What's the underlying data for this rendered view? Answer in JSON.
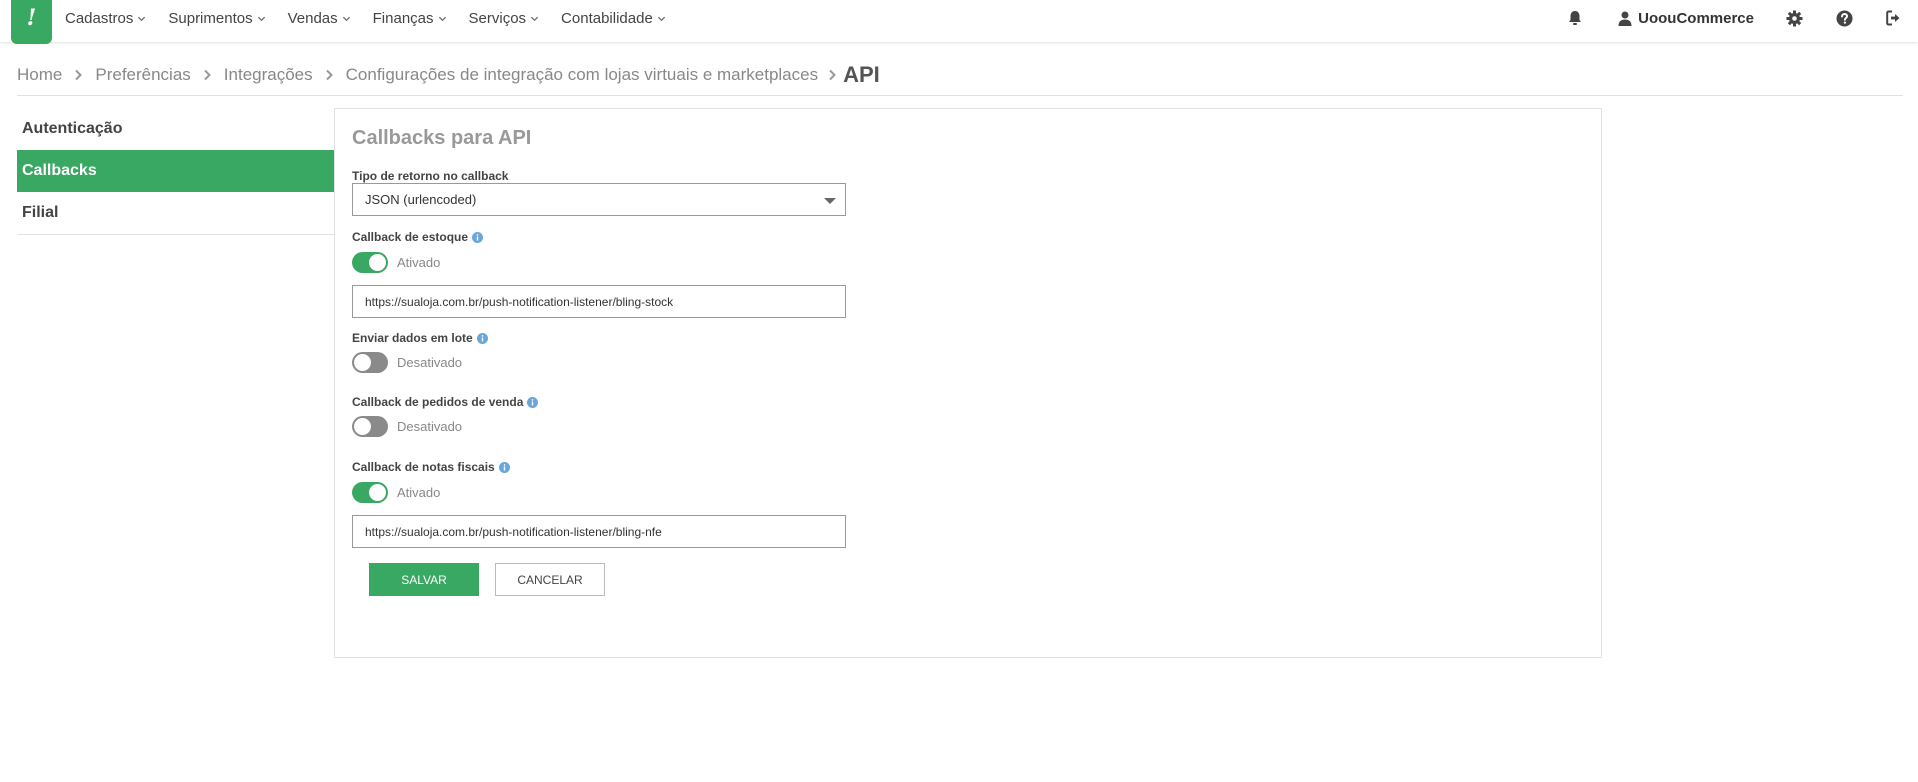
{
  "nav": {
    "logo_text": "!",
    "menu": [
      {
        "label": "Cadastros"
      },
      {
        "label": "Suprimentos"
      },
      {
        "label": "Vendas"
      },
      {
        "label": "Finanças"
      },
      {
        "label": "Serviços"
      },
      {
        "label": "Contabilidade"
      }
    ],
    "user_name": "UoouCommerce",
    "icons": [
      "bell-icon",
      "user-icon",
      "gear-icon",
      "help-icon",
      "logout-icon"
    ]
  },
  "breadcrumb": {
    "items": [
      "Home",
      "Preferências",
      "Integrações",
      "Configurações de integração com lojas virtuais e marketplaces"
    ],
    "current": "API"
  },
  "sidebar": {
    "items": [
      {
        "label": "Autenticação",
        "active": false
      },
      {
        "label": "Callbacks",
        "active": true
      },
      {
        "label": "Filial",
        "active": false
      }
    ]
  },
  "panel": {
    "title": "Callbacks para API",
    "return_type": {
      "label": "Tipo de retorno no callback",
      "value": "JSON (urlencoded)"
    },
    "stock_callback": {
      "label": "Callback de estoque",
      "enabled": true,
      "status": "Ativado",
      "url": "https://sualoja.com.br/push-notification-listener/bling-stock"
    },
    "batch": {
      "label": "Enviar dados em lote",
      "enabled": false,
      "status": "Desativado"
    },
    "orders_callback": {
      "label": "Callback de pedidos de venda",
      "enabled": false,
      "status": "Desativado"
    },
    "nfe_callback": {
      "label": "Callback de notas fiscais",
      "enabled": true,
      "status": "Ativado",
      "url": "https://sualoja.com.br/push-notification-listener/bling-nfe"
    },
    "save_label": "SALVAR",
    "cancel_label": "CANCELAR"
  },
  "colors": {
    "accent": "#38a862",
    "info": "#6aa6d8"
  }
}
